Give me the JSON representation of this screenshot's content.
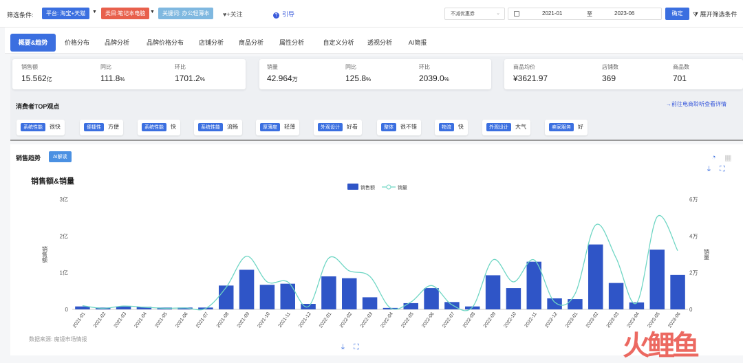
{
  "filters": {
    "label": "筛选条件:",
    "platform": "平台: 淘宝+天猫",
    "category": "类目:笔记本电脑",
    "keyword": "关键词: 办公轻薄本",
    "follow": "+关注",
    "guide": "引导",
    "discount_select": "不减优惠券",
    "date_start": "2021-01",
    "date_sep": "至",
    "date_end": "2023-06",
    "confirm": "确定",
    "expand": "展开筛选条件",
    "colors": {
      "platform": "#3b6fe0",
      "category": "#e8604c",
      "keyword": "#7fb8e0"
    }
  },
  "tabs": [
    "概要&趋势",
    "价格分布",
    "品牌分析",
    "品牌价格分布",
    "店铺分析",
    "商品分析",
    "属性分析",
    "自定义分析",
    "透视分析",
    "AI简报"
  ],
  "metrics": {
    "sales": {
      "label": "销售额",
      "value": "15.562",
      "unit": "亿"
    },
    "sales_yoy": {
      "label": "同比",
      "value": "111.8",
      "unit": "%"
    },
    "sales_mom": {
      "label": "环比",
      "value": "1701.2",
      "unit": "%"
    },
    "volume": {
      "label": "销量",
      "value": "42.964",
      "unit": "万"
    },
    "volume_yoy": {
      "label": "同比",
      "value": "125.8",
      "unit": "%"
    },
    "volume_mom": {
      "label": "环比",
      "value": "2039.0",
      "unit": "%"
    },
    "avg_price": {
      "label": "商品均价",
      "value": "¥3621.97"
    },
    "shops": {
      "label": "店铺数",
      "value": "369"
    },
    "products": {
      "label": "商品数",
      "value": "701"
    }
  },
  "consumer": {
    "title": "消费者TOP观点",
    "link": "→前往电商聆听查看详情",
    "tags": [
      {
        "k": "系统性能",
        "v": "很快"
      },
      {
        "k": "便捷性",
        "v": "方便"
      },
      {
        "k": "系统性能",
        "v": "快"
      },
      {
        "k": "系统性能",
        "v": "流畅"
      },
      {
        "k": "厚薄度",
        "v": "轻薄"
      },
      {
        "k": "外观设计",
        "v": "好看"
      },
      {
        "k": "整体",
        "v": "很不错"
      },
      {
        "k": "物流",
        "v": "快"
      },
      {
        "k": "外观设计",
        "v": "大气"
      },
      {
        "k": "卖家服务",
        "v": "好"
      }
    ]
  },
  "trend": {
    "title": "销售趋势",
    "ai_badge": "AI解读",
    "source": "数据来源: 魔镜市场情报",
    "watermark": "火鲤鱼"
  },
  "chart_data": {
    "type": "bar",
    "title": "销售额&销量",
    "ylabel": "销售额",
    "y2label": "销量",
    "ylim": [
      0,
      3
    ],
    "y2lim": [
      0,
      6
    ],
    "y_ticks": [
      "0",
      "1亿",
      "2亿",
      "3亿"
    ],
    "y2_ticks": [
      "0",
      "2万",
      "4万",
      "6万"
    ],
    "legend": "top-center",
    "categories": [
      "2021-01",
      "2021-02",
      "2021-03",
      "2021-04",
      "2021-05",
      "2021-06",
      "2021-07",
      "2021-08",
      "2021-09",
      "2021-10",
      "2021-11",
      "2021-12",
      "2022-01",
      "2022-02",
      "2022-03",
      "2022-04",
      "2022-05",
      "2022-06",
      "2022-07",
      "2022-08",
      "2022-09",
      "2022-10",
      "2022-11",
      "2022-12",
      "2023-01",
      "2023-02",
      "2023-03",
      "2023-04",
      "2023-05",
      "2023-06"
    ],
    "series": [
      {
        "name": "销售额",
        "type": "bar",
        "unit": "亿",
        "color": "#2f55c7",
        "values": [
          0.08,
          0.05,
          0.08,
          0.07,
          0.05,
          0.05,
          0.05,
          0.65,
          1.08,
          0.67,
          0.7,
          0.15,
          0.9,
          0.85,
          0.33,
          0.04,
          0.17,
          0.58,
          0.2,
          0.08,
          0.93,
          0.58,
          1.3,
          0.3,
          0.28,
          1.77,
          0.72,
          0.19,
          1.63,
          0.94
        ]
      },
      {
        "name": "销量",
        "type": "line",
        "unit": "万",
        "color": "#6fd6c4",
        "values": [
          0.2,
          0.06,
          0.18,
          0.12,
          0.06,
          0.08,
          0.05,
          1.2,
          2.9,
          1.5,
          1.5,
          0.15,
          2.8,
          2.1,
          1.8,
          0.08,
          0.4,
          1.3,
          0.25,
          0.12,
          2.7,
          1.5,
          2.7,
          0.4,
          0.85,
          4.6,
          2.8,
          0.35,
          5.05,
          3.2
        ]
      }
    ]
  }
}
